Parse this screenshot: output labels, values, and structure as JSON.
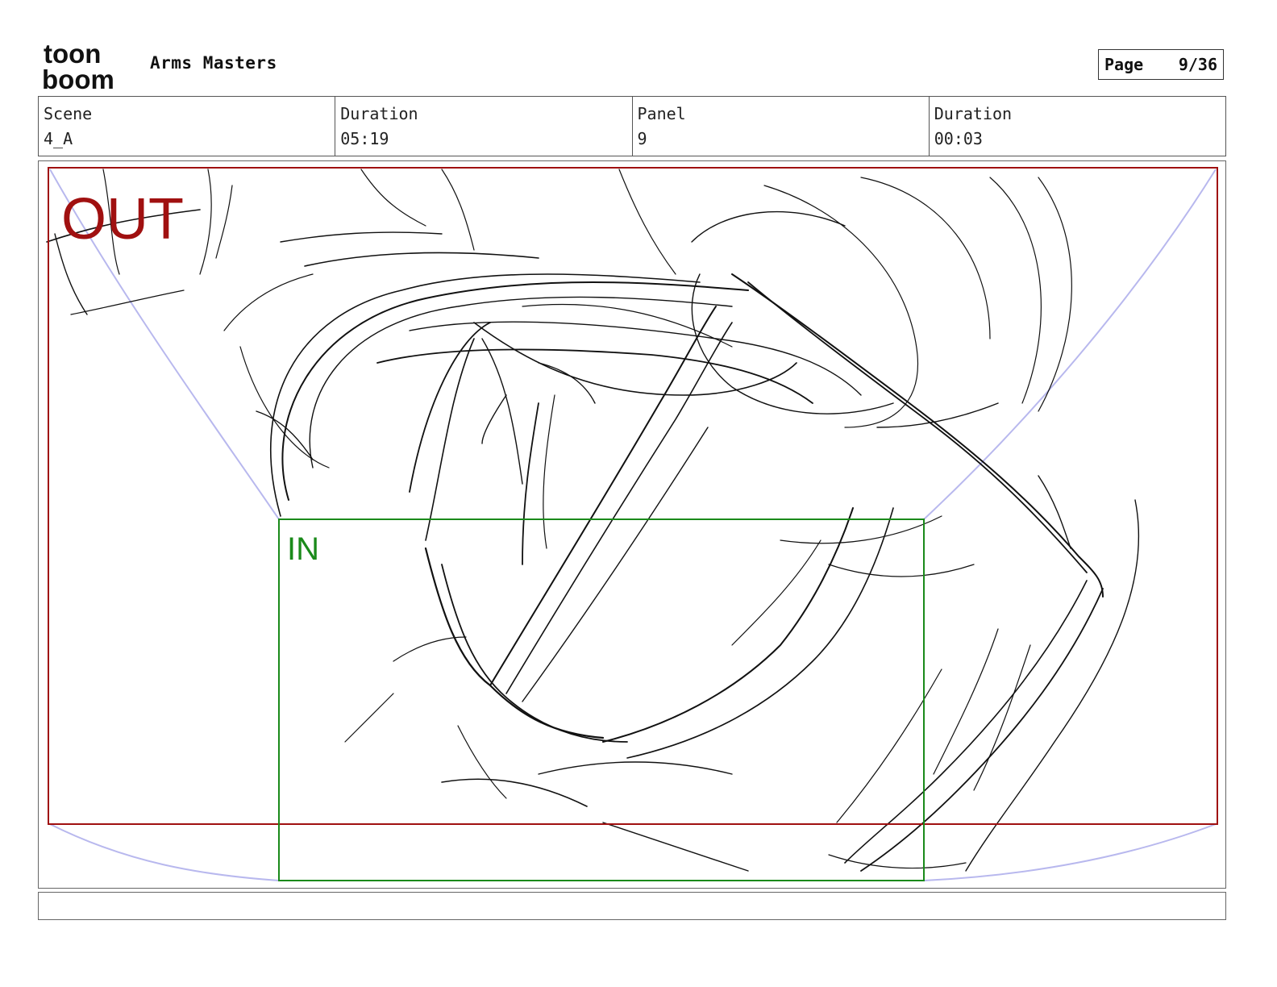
{
  "header": {
    "logo_text_top": "toon",
    "logo_text_bottom": "boom",
    "project_title": "Arms Masters",
    "page_label": "Page",
    "page_value": "9/36"
  },
  "info": {
    "scene_label": "Scene",
    "scene_value": "4_A",
    "scene_duration_label": "Duration",
    "scene_duration_value": "05:19",
    "panel_label": "Panel",
    "panel_value": "9",
    "panel_duration_label": "Duration",
    "panel_duration_value": "00:03"
  },
  "panel": {
    "out_label": "OUT",
    "in_label": "IN",
    "out_color": "#a01010",
    "in_color": "#1a8a1a",
    "guide_color": "#b8b8ee"
  },
  "caption": {
    "text": ""
  }
}
